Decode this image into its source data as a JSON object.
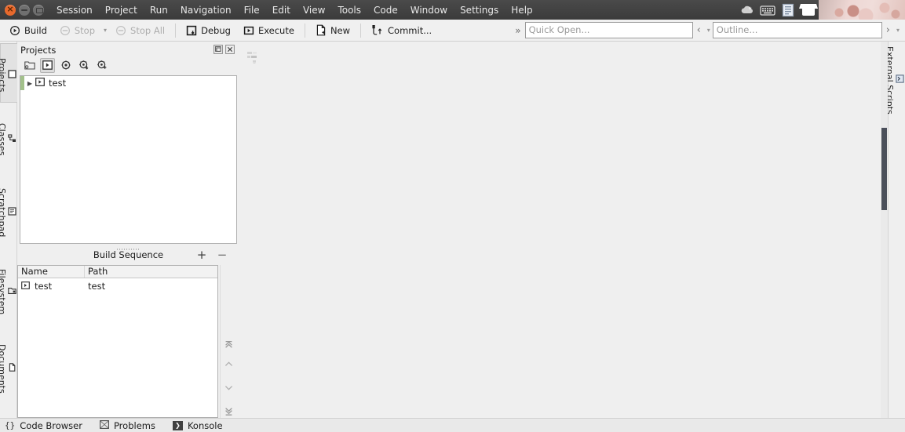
{
  "window": {
    "buttons": [
      {
        "name": "close",
        "label": "Close"
      },
      {
        "name": "minimize",
        "label": "Minimize"
      },
      {
        "name": "maximize",
        "label": "Maximize"
      }
    ]
  },
  "menubar": {
    "items": [
      "Session",
      "Project",
      "Run",
      "Navigation",
      "File",
      "Edit",
      "View",
      "Tools",
      "Code",
      "Window",
      "Settings",
      "Help"
    ]
  },
  "tray": {
    "icons": [
      "weather-cloud-icon",
      "keyboard-icon",
      "clipboard-icon",
      "tshirt-icon",
      "cat-photo"
    ]
  },
  "toolbar": {
    "build_label": "Build",
    "stop_label": "Stop",
    "stop_all_label": "Stop All",
    "debug_label": "Debug",
    "execute_label": "Execute",
    "new_label": "New",
    "commit_label": "Commit...",
    "overflow_label": "»",
    "quick_open_placeholder": "Quick Open...",
    "outline_placeholder": "Outline...",
    "back_label": "‹",
    "forward_label": "›"
  },
  "left_tabs": {
    "items": [
      {
        "label": "Projects",
        "icon": "projects-icon",
        "active": true
      },
      {
        "label": "Classes",
        "icon": "classes-icon",
        "active": false
      },
      {
        "label": "Scratchpad",
        "icon": "scratchpad-icon",
        "active": false
      },
      {
        "label": "Filesystem",
        "icon": "filesystem-icon",
        "active": false
      },
      {
        "label": "Documents",
        "icon": "documents-icon",
        "active": false
      }
    ]
  },
  "right_tabs": {
    "items": [
      {
        "label": "External Scripts",
        "icon": "external-scripts-icon",
        "active": false
      }
    ]
  },
  "projects_dock": {
    "title": "Projects",
    "float_button": "float-icon",
    "close_button": "close-icon",
    "toolbar_buttons": [
      {
        "name": "open-project-button",
        "icon": "folder-open-icon",
        "checked": false
      },
      {
        "name": "run-project-button",
        "icon": "project-run-icon",
        "checked": true
      },
      {
        "name": "project-settings-button",
        "icon": "gear-icon",
        "checked": false
      },
      {
        "name": "project-build-settings-button",
        "icon": "gear-down-icon",
        "checked": false
      },
      {
        "name": "project-config-button",
        "icon": "gear-add-icon",
        "checked": false
      }
    ],
    "tree": [
      {
        "label": "test",
        "icon": "project-icon",
        "expanded": false,
        "marked": true
      }
    ]
  },
  "build_sequence": {
    "title": "Build Sequence",
    "add_label": "+",
    "remove_label": "−",
    "columns": [
      "Name",
      "Path"
    ],
    "rows": [
      {
        "name": "test",
        "path": "test",
        "icon": "project-icon"
      }
    ],
    "nav_buttons": [
      {
        "name": "move-to-top-button",
        "icon": "double-chevron-up-icon"
      },
      {
        "name": "move-up-button",
        "icon": "chevron-up-icon"
      },
      {
        "name": "move-down-button",
        "icon": "chevron-down-icon"
      },
      {
        "name": "move-to-bottom-button",
        "icon": "double-chevron-down-icon"
      }
    ]
  },
  "editor": {
    "placeholder_icon": "empty-editor-icon"
  },
  "statusbar": {
    "items": [
      {
        "label": "Code Browser",
        "icon": "braces-icon"
      },
      {
        "label": "Problems",
        "icon": "problems-icon"
      },
      {
        "label": "Konsole",
        "icon": "konsole-icon"
      }
    ]
  },
  "colors": {
    "titlebar": "#3f3f3f",
    "toolbar": "#f0f0f0",
    "panel": "#efefef",
    "field": "#ffffff",
    "accent_marker": "#a2c08a",
    "close_button": "#e8692c",
    "scrollbar_thumb": "#4a4f5a"
  }
}
